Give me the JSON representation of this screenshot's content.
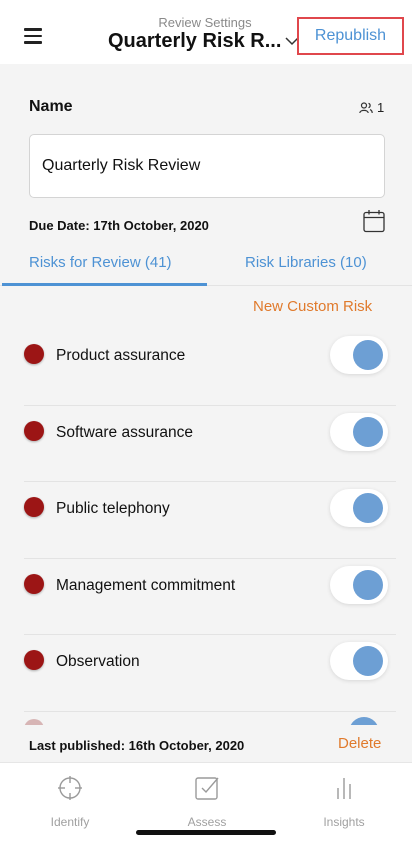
{
  "header": {
    "subtitle": "Review Settings",
    "title": "Quarterly Risk R...",
    "republish_label": "Republish"
  },
  "name_section": {
    "label": "Name",
    "participant_count": "1",
    "value": "Quarterly Risk Review"
  },
  "due_date": "Due Date: 17th October, 2020",
  "tabs": [
    {
      "label": "Risks for Review (41)",
      "active": true
    },
    {
      "label": "Risk Libraries (10)",
      "active": false
    }
  ],
  "new_custom_risk_label": "New Custom Risk",
  "risks": [
    {
      "label": "Product assurance",
      "enabled": true
    },
    {
      "label": "Software assurance",
      "enabled": true
    },
    {
      "label": "Public telephony",
      "enabled": true
    },
    {
      "label": "Management commitment",
      "enabled": true
    },
    {
      "label": "Observation",
      "enabled": true
    }
  ],
  "footer": {
    "last_published": "Last published: 16th October, 2020",
    "delete_label": "Delete"
  },
  "tabbar": [
    {
      "label": "Identify",
      "icon": "crosshair-icon"
    },
    {
      "label": "Assess",
      "icon": "checkbox-icon"
    },
    {
      "label": "Insights",
      "icon": "bar-chart-icon"
    }
  ],
  "colors": {
    "accent": "#4d92d4",
    "orange": "#e07a2c",
    "risk_dot": "#9c1515",
    "highlight_border": "#e0474c",
    "toggle_knob": "#6d9fd4"
  }
}
